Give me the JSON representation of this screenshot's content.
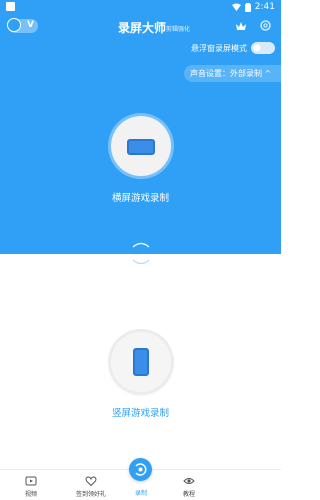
{
  "status": {
    "time": "2:41"
  },
  "header": {
    "title": "录屏大师",
    "subtitle": "剪辑强化",
    "vip_mark": "V"
  },
  "float_mode": {
    "label": "悬浮窗录屏模式",
    "enabled": false
  },
  "audio_setting": {
    "label": "声音设置：外部录制 ^"
  },
  "modes": {
    "landscape_label": "横屏游戏录制",
    "portrait_label": "竖屏游戏录制"
  },
  "nav": {
    "items": [
      {
        "label": "视频",
        "icon": "video-icon"
      },
      {
        "label": "签到领好礼",
        "icon": "heart-icon"
      },
      {
        "label": "录制",
        "icon": "record-icon"
      },
      {
        "label": "教程",
        "icon": "eye-icon"
      }
    ]
  },
  "colors": {
    "primary": "#2fa0f5",
    "phone": "#3b8ee8"
  }
}
